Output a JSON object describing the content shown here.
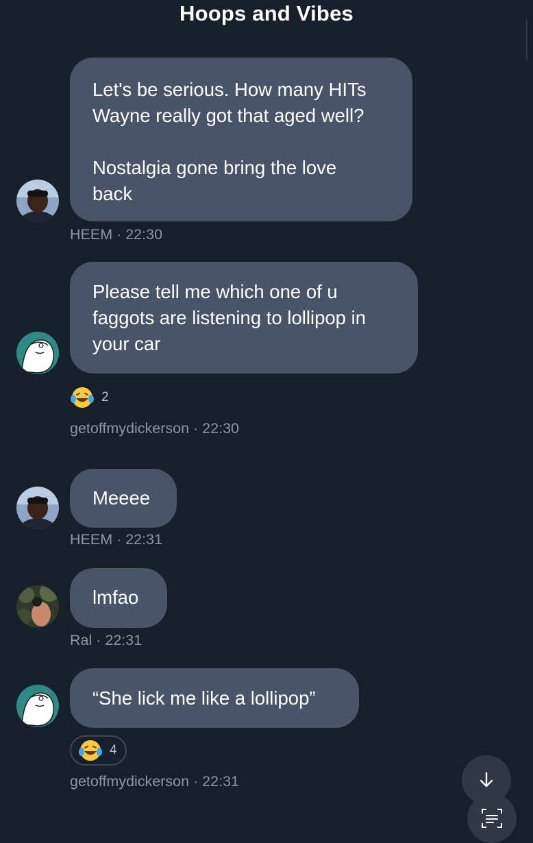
{
  "header": {
    "title": "Hoops and Vibes"
  },
  "messages": [
    {
      "sender": "HEEM",
      "time": "22:30",
      "meta": "HEEM · 22:30",
      "text": "Let's be serious. How many HITs\nWayne really got that aged well?\n\nNostalgia gone bring the love\nback"
    },
    {
      "sender": "getoffmydickerson",
      "time": "22:30",
      "meta": "getoffmydickerson · 22:30",
      "text": "Please tell me which one of u\nfaggots are listening to lollipop in\nyour car",
      "reaction": {
        "icon": "laughing-tears-emoji",
        "count": "2"
      }
    },
    {
      "sender": "HEEM",
      "time": "22:31",
      "meta": "HEEM · 22:31",
      "text": "Meeee"
    },
    {
      "sender": "Ral",
      "time": "22:31",
      "meta": "Ral · 22:31",
      "text": "lmfao"
    },
    {
      "sender": "getoffmydickerson",
      "time": "22:31",
      "meta": "getoffmydickerson · 22:31",
      "text": "“She lick me like a lollipop”",
      "reaction": {
        "icon": "laughing-tears-emoji",
        "count": "4"
      }
    }
  ],
  "buttons": {
    "scroll_down_icon": "arrow-down-icon",
    "menu_icon": "list-scan-icon"
  },
  "colors": {
    "background": "#171f2a",
    "bubble": "#485467",
    "meta_text": "#8d97a3"
  }
}
